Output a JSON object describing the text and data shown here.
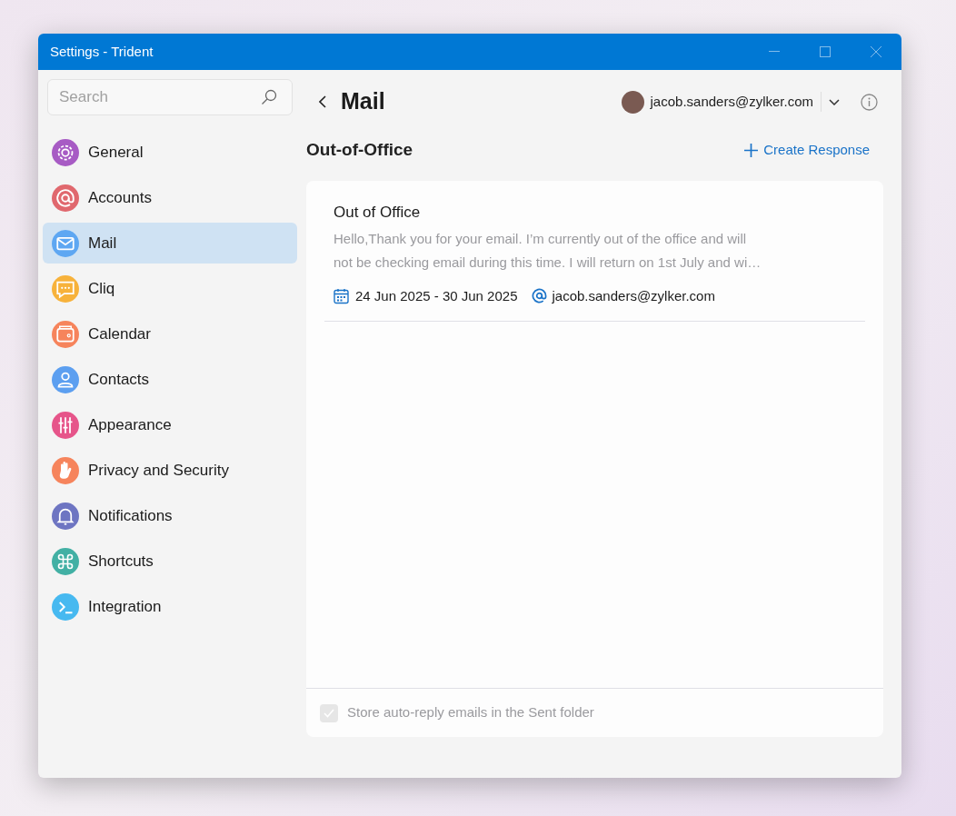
{
  "window": {
    "title": "Settings - Trident"
  },
  "sidebar": {
    "search": {
      "placeholder": "Search"
    },
    "items": [
      {
        "label": "General",
        "color": "#a75bc4",
        "selected": false
      },
      {
        "label": "Accounts",
        "color": "#e0686e",
        "selected": false
      },
      {
        "label": "Mail",
        "color": "#5ea7f2",
        "selected": true
      },
      {
        "label": "Cliq",
        "color": "#f7b23b",
        "selected": false
      },
      {
        "label": "Calendar",
        "color": "#f6845c",
        "selected": false
      },
      {
        "label": "Contacts",
        "color": "#5c9ff0",
        "selected": false
      },
      {
        "label": "Appearance",
        "color": "#e6558a",
        "selected": false
      },
      {
        "label": "Privacy and Security",
        "color": "#f6845c",
        "selected": false
      },
      {
        "label": "Notifications",
        "color": "#6e75c2",
        "selected": false
      },
      {
        "label": "Shortcuts",
        "color": "#42b0a4",
        "selected": false
      },
      {
        "label": "Integration",
        "color": "#47b9f0",
        "selected": false
      }
    ]
  },
  "header": {
    "title": "Mail",
    "account": "jacob.sanders@zylker.com"
  },
  "section": {
    "title": "Out-of-Office",
    "action": "Create Response"
  },
  "responses": [
    {
      "title": "Out of Office",
      "message": "Hello,Thank you for your email. I’m currently out of the office and will not be checking email during this time. I will return on 1st July and wi…",
      "dates": "24 Jun 2025 - 30 Jun 2025",
      "account": "jacob.sanders@zylker.com"
    }
  ],
  "store_option": {
    "label": "Store auto-reply emails in the Sent folder",
    "checked": true,
    "disabled": true
  }
}
